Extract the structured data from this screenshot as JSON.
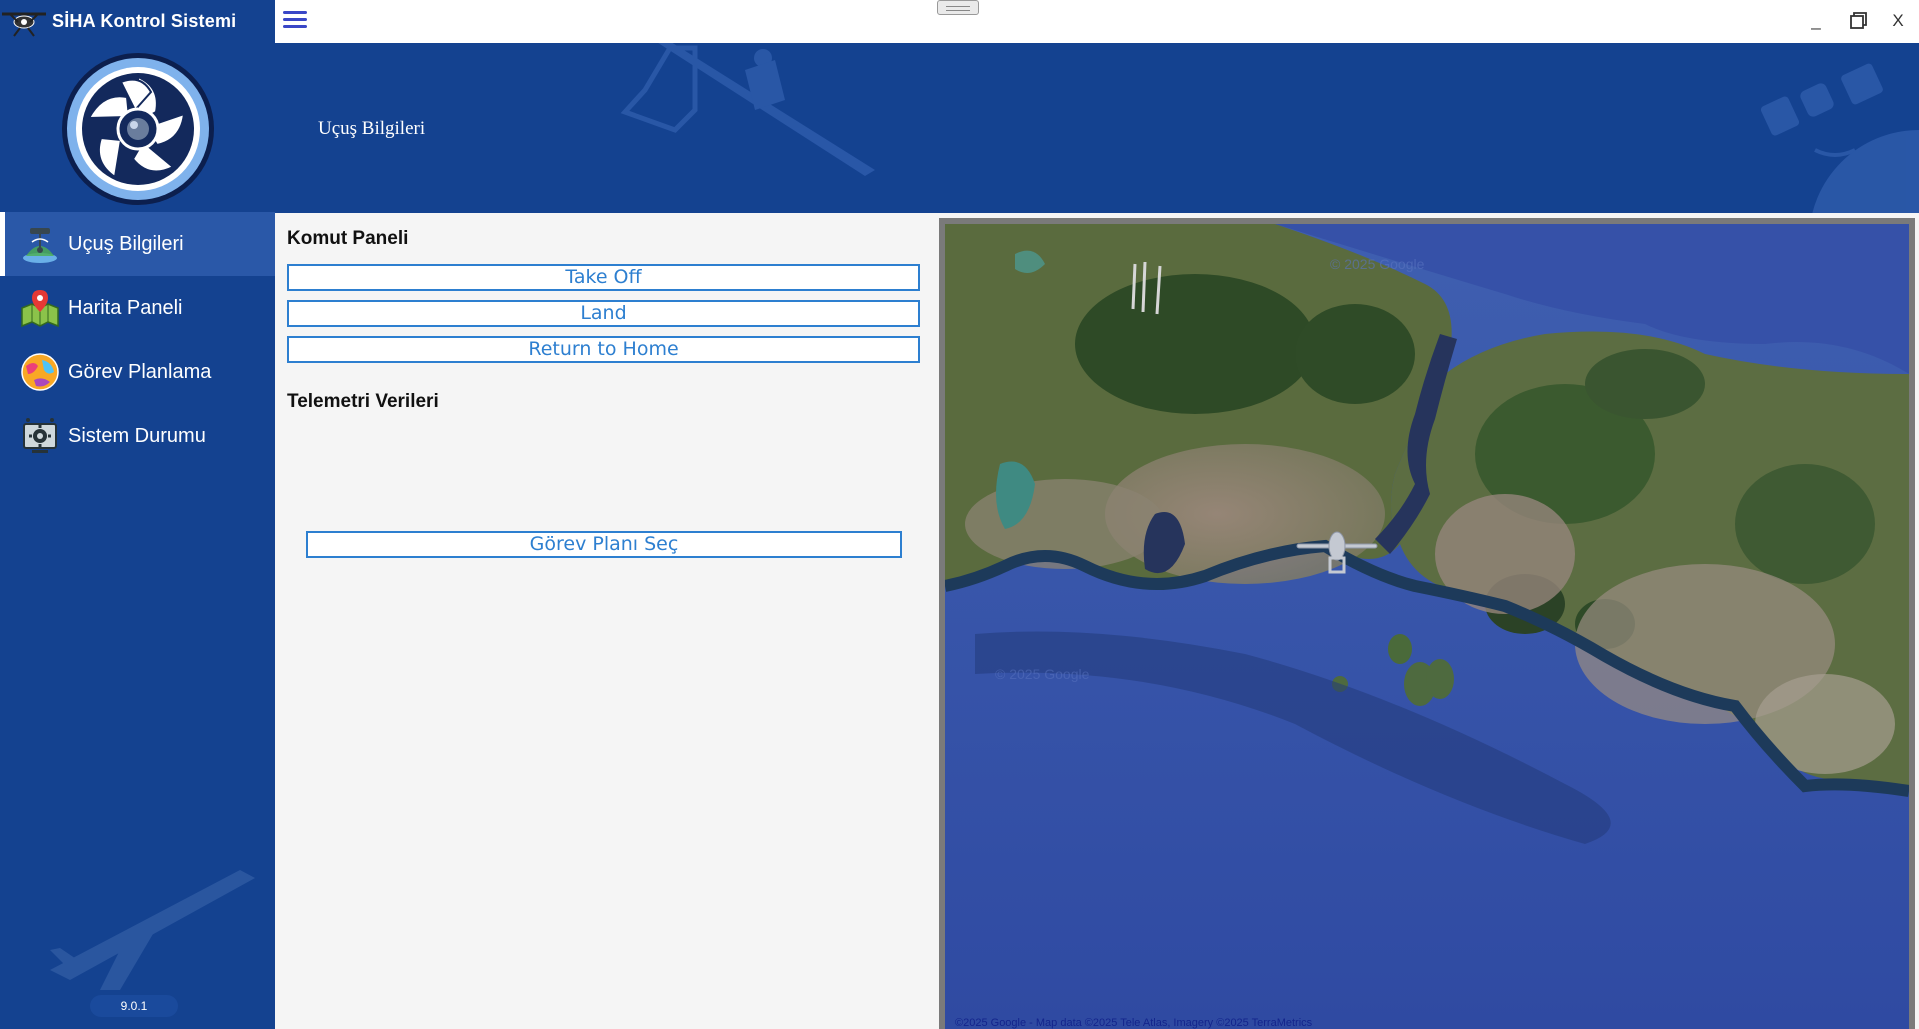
{
  "app": {
    "title": "SİHA Kontrol Sistemi",
    "version": "9.0.1"
  },
  "nav": {
    "items": [
      {
        "label": "Uçuş Bilgileri",
        "icon": "drone-radar-icon",
        "active": true
      },
      {
        "label": "Harita Paneli",
        "icon": "map-pin-icon",
        "active": false
      },
      {
        "label": "Görev Planlama",
        "icon": "globe-icon",
        "active": false
      },
      {
        "label": "Sistem Durumu",
        "icon": "gear-monitor-icon",
        "active": false
      }
    ]
  },
  "window": {
    "minimize": "_",
    "close": "X"
  },
  "header": {
    "title": "Uçuş Bilgileri"
  },
  "command_panel": {
    "title": "Komut Paneli",
    "buttons": {
      "take_off": "Take Off",
      "land": "Land",
      "return_home": "Return to Home"
    }
  },
  "telemetry": {
    "title": "Telemetri Verileri",
    "select_plan": "Görev Planı Seç"
  },
  "map": {
    "attribution": "©2025 Google - Map data ©2025 Tele Atlas, Imagery ©2025 TerraMetrics",
    "watermark": "© 2025 Google"
  },
  "colors": {
    "primary": "#144290",
    "active_nav": "#2a58a8",
    "button_accent": "#2d7fd0",
    "panel_bg": "#f5f5f5"
  }
}
